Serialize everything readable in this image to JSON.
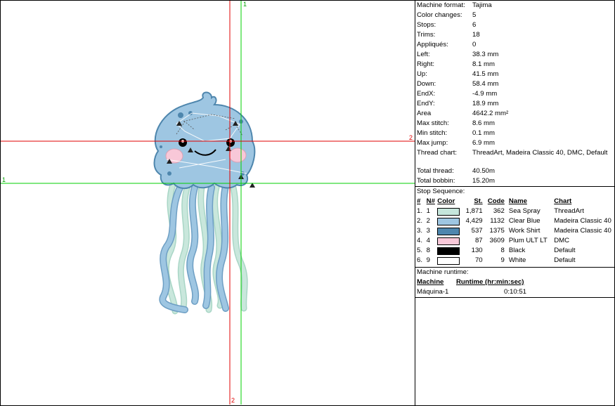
{
  "axes": {
    "green_label_top": "1",
    "green_label_left": "1",
    "red_label_right": "2",
    "red_label_bottom": "2"
  },
  "stats": [
    {
      "label": "Machine format:",
      "value": "Tajima"
    },
    {
      "label": "Color changes:",
      "value": "5"
    },
    {
      "label": "Stops:",
      "value": "6"
    },
    {
      "label": "Trims:",
      "value": "18"
    },
    {
      "label": "Appliqués:",
      "value": "0"
    },
    {
      "label": "Left:",
      "value": "38.3 mm"
    },
    {
      "label": "Right:",
      "value": "8.1 mm"
    },
    {
      "label": "Up:",
      "value": "41.5 mm"
    },
    {
      "label": "Down:",
      "value": "58.4 mm"
    },
    {
      "label": "EndX:",
      "value": "-4.9 mm"
    },
    {
      "label": "EndY:",
      "value": "18.9 mm"
    },
    {
      "label": "Area",
      "value": "4642.2 mm²"
    },
    {
      "label": "Max stitch:",
      "value": "8.6 mm"
    },
    {
      "label": "Min stitch:",
      "value": "0.1 mm"
    },
    {
      "label": "Max jump:",
      "value": "6.9 mm"
    },
    {
      "label": "Thread chart:",
      "value": "ThreadArt, Madeira Classic 40, DMC, Default"
    },
    {
      "label": "Total thread:",
      "value": "40.50m"
    },
    {
      "label": "Total bobbin:",
      "value": "15.20m"
    }
  ],
  "stop_sequence": {
    "title": "Stop Sequence:",
    "headers": {
      "idx": "#",
      "n": "N#",
      "color": "Color",
      "st": "St.",
      "code": "Code",
      "name": "Name",
      "chart": "Chart"
    },
    "rows": [
      {
        "idx": "1.",
        "n": "1",
        "color": "#c6e6dc",
        "st": "1,871",
        "code": "362",
        "name": "Sea Spray",
        "chart": "ThreadArt"
      },
      {
        "idx": "2.",
        "n": "2",
        "color": "#9ec6e2",
        "st": "4,429",
        "code": "1132",
        "name": "Clear Blue",
        "chart": "Madeira Classic 40"
      },
      {
        "idx": "3.",
        "n": "3",
        "color": "#4e86ad",
        "st": "537",
        "code": "1375",
        "name": "Work Shirt",
        "chart": "Madeira Classic 40"
      },
      {
        "idx": "4.",
        "n": "4",
        "color": "#f8c8d8",
        "st": "87",
        "code": "3609",
        "name": "Plum ULT LT",
        "chart": "DMC"
      },
      {
        "idx": "5.",
        "n": "8",
        "color": "#000000",
        "st": "130",
        "code": "8",
        "name": "Black",
        "chart": "Default"
      },
      {
        "idx": "6.",
        "n": "9",
        "color": "#ffffff",
        "st": "70",
        "code": "9",
        "name": "White",
        "chart": "Default"
      }
    ]
  },
  "machine_runtime": {
    "title": "Machine runtime:",
    "col_machine": "Machine",
    "col_runtime": "Runtime (hr:min:sec)",
    "rows": [
      {
        "machine": "Máquina-1",
        "runtime": "0:10:51"
      }
    ]
  }
}
